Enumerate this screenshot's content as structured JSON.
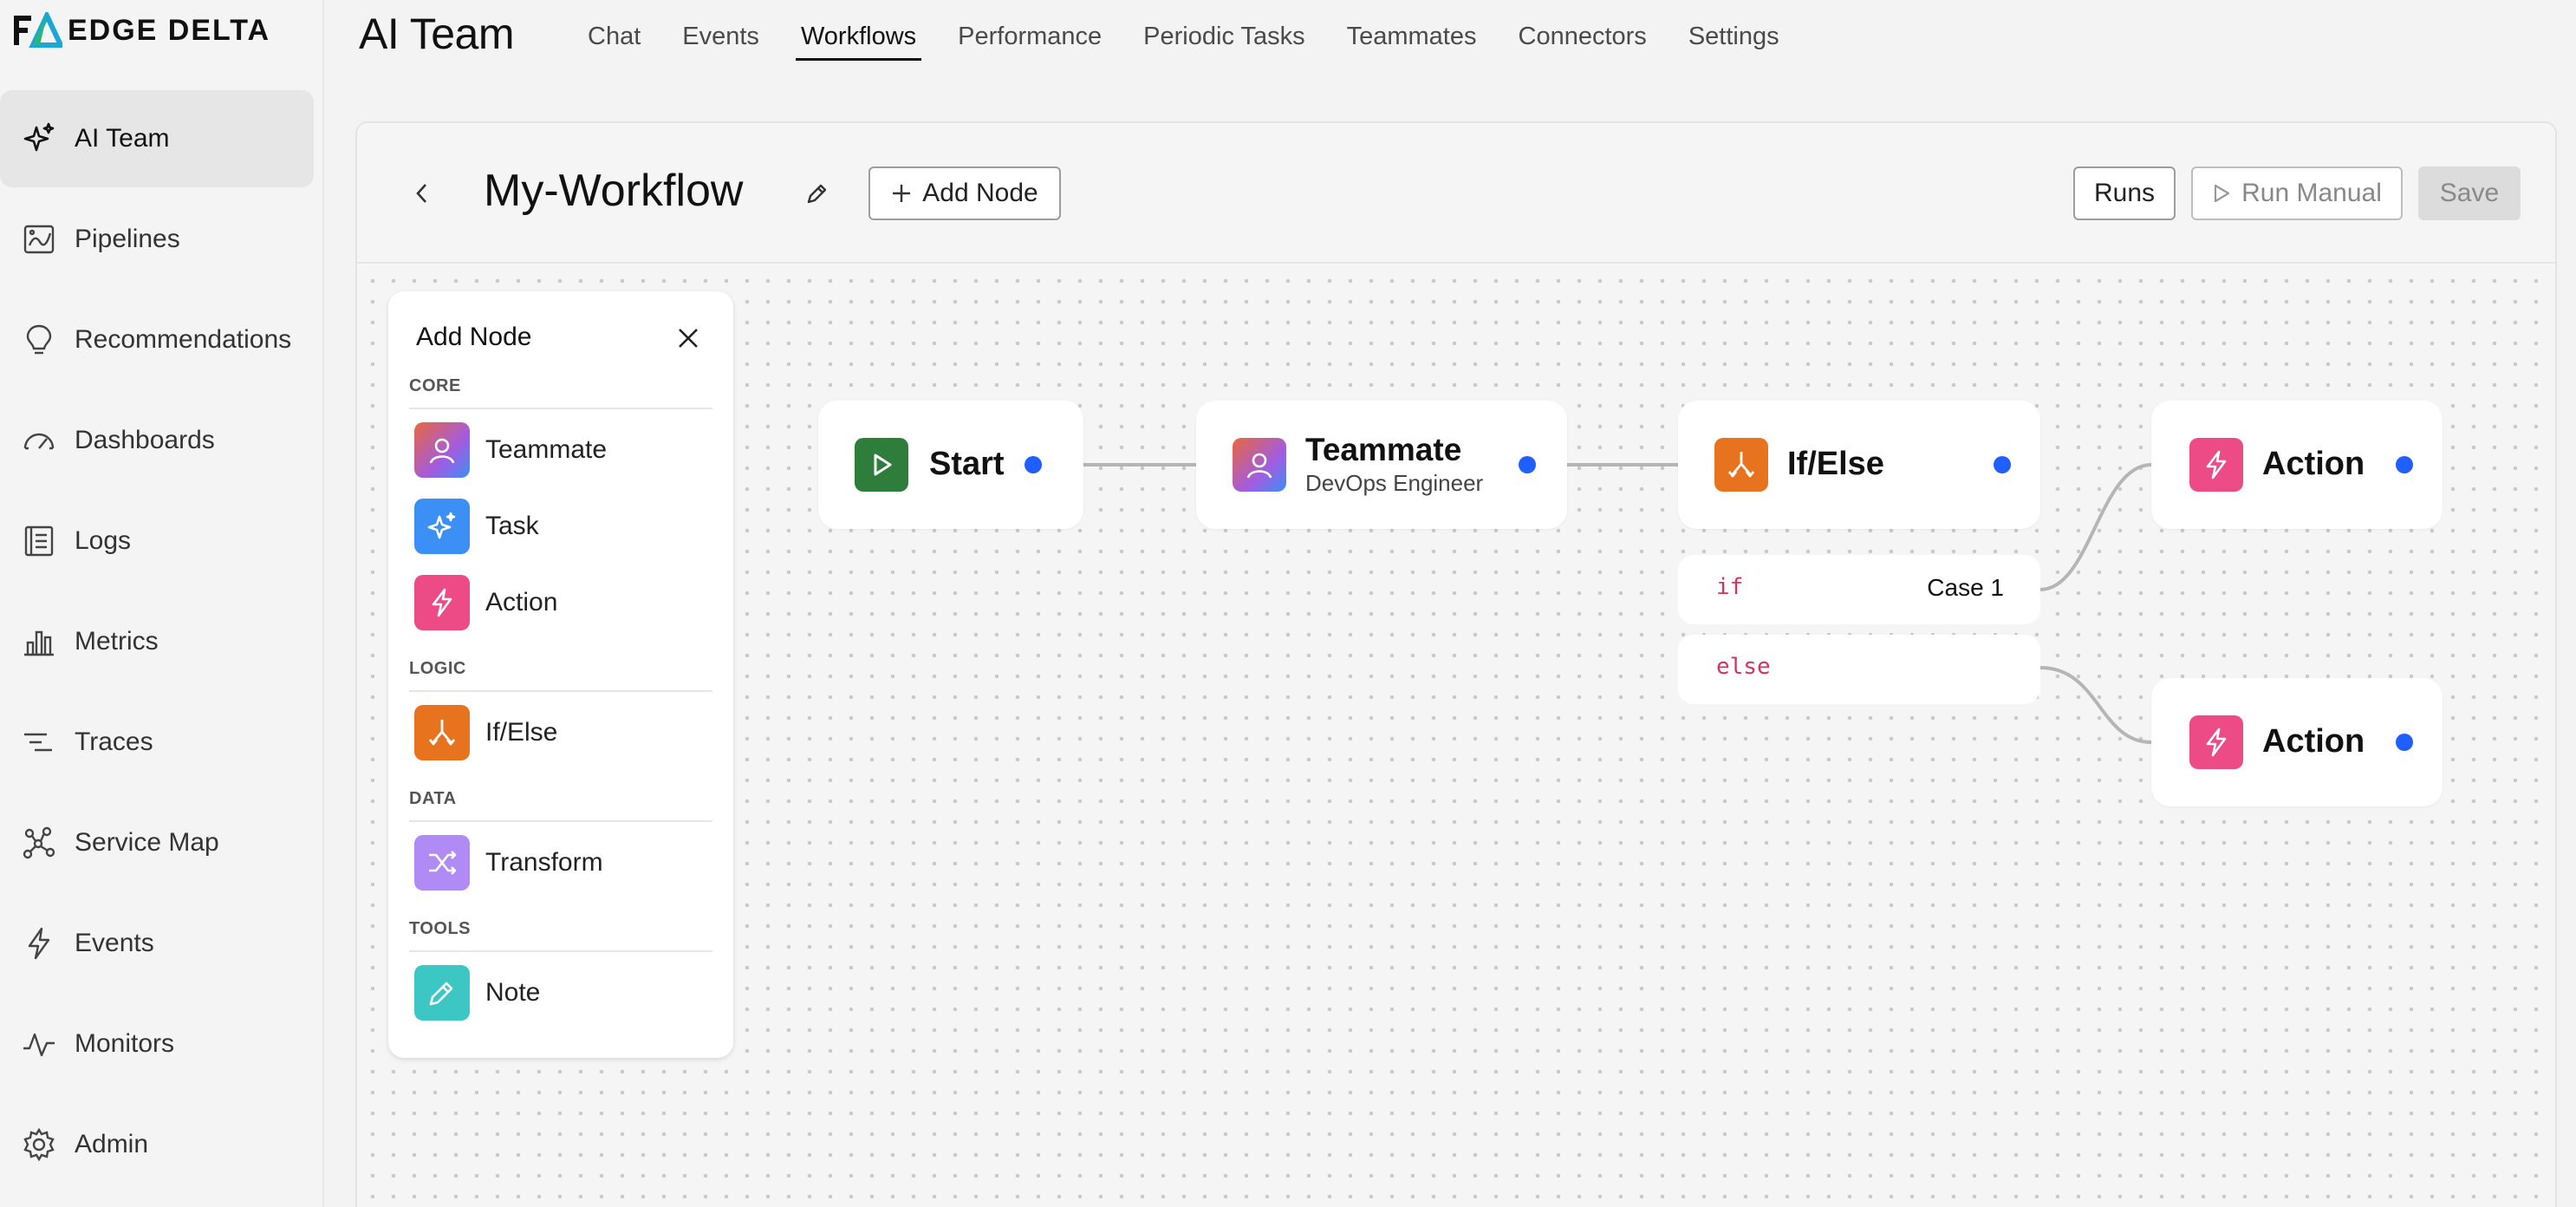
{
  "brand": {
    "logo_text": "EDGE DELTA"
  },
  "sidebar": {
    "items": [
      {
        "label": "AI Team",
        "icon": "sparkle-icon",
        "active": true
      },
      {
        "label": "Pipelines",
        "icon": "pipelines-icon"
      },
      {
        "label": "Recommendations",
        "icon": "lightbulb-icon"
      },
      {
        "label": "Dashboards",
        "icon": "gauge-icon"
      },
      {
        "label": "Logs",
        "icon": "logs-icon"
      },
      {
        "label": "Metrics",
        "icon": "bar-chart-icon"
      },
      {
        "label": "Traces",
        "icon": "traces-icon"
      },
      {
        "label": "Service Map",
        "icon": "service-map-icon"
      },
      {
        "label": "Events",
        "icon": "lightning-icon"
      },
      {
        "label": "Monitors",
        "icon": "pulse-icon"
      },
      {
        "label": "Admin",
        "icon": "gear-icon"
      }
    ]
  },
  "header": {
    "title": "AI Team",
    "tabs": [
      "Chat",
      "Events",
      "Workflows",
      "Performance",
      "Periodic Tasks",
      "Teammates",
      "Connectors",
      "Settings"
    ],
    "active_tab": "Workflows"
  },
  "workflow": {
    "name": "My-Workflow",
    "add_node_label": "Add Node",
    "runs_label": "Runs",
    "run_manual_label": "Run Manual",
    "save_label": "Save"
  },
  "palette": {
    "title": "Add Node",
    "sections": [
      {
        "name": "CORE",
        "items": [
          "Teammate",
          "Task",
          "Action"
        ]
      },
      {
        "name": "LOGIC",
        "items": [
          "If/Else"
        ]
      },
      {
        "name": "DATA",
        "items": [
          "Transform"
        ]
      },
      {
        "name": "TOOLS",
        "items": [
          "Note"
        ]
      }
    ]
  },
  "nodes": {
    "start": {
      "label": "Start"
    },
    "teammate": {
      "label": "Teammate",
      "subtitle": "DevOps Engineer"
    },
    "ifelse": {
      "label": "If/Else",
      "if_code": "if",
      "if_case": "Case 1",
      "else_code": "else"
    },
    "action1": {
      "label": "Action"
    },
    "action2": {
      "label": "Action"
    }
  },
  "colors": {
    "accent_port": "#1f5eff",
    "start_green": "#2e7d3a",
    "ifelse_orange": "#e8731e",
    "action_pink": "#ec4b86",
    "task_blue": "#3b8ff5",
    "transform_purple": "#b08af5",
    "note_teal": "#3cc6c4",
    "branch_code": "#d6325f"
  }
}
